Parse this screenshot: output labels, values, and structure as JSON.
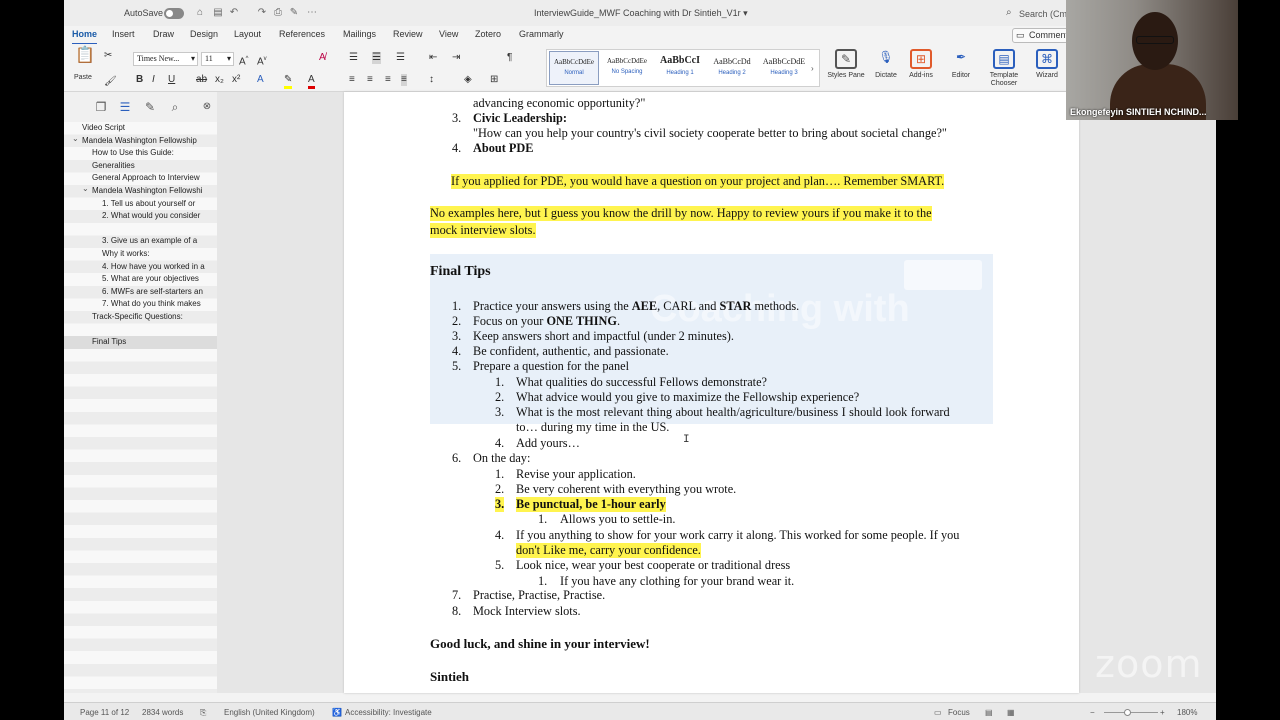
{
  "titlebar": {
    "autosave": "AutoSave",
    "filename": "InterviewGuide_MWF Coaching with Dr Sintieh_V1r",
    "search": "Search (Cm"
  },
  "tabs": [
    "Home",
    "Insert",
    "Draw",
    "Design",
    "Layout",
    "References",
    "Mailings",
    "Review",
    "View",
    "Zotero",
    "Grammarly"
  ],
  "comment": "Comment",
  "ribbon": {
    "paste": "Paste",
    "font": "Times New...",
    "size": "11",
    "styles": [
      {
        "preview": "AaBbCcDdEe",
        "name": "Normal"
      },
      {
        "preview": "AaBbCcDdEe",
        "name": "No Spacing"
      },
      {
        "preview": "AaBbCcI",
        "name": "Heading 1"
      },
      {
        "preview": "AaBbCcDd",
        "name": "Heading 2"
      },
      {
        "preview": "AaBbCcDdE",
        "name": "Heading 3"
      }
    ],
    "styles_pane": "Styles Pane",
    "dictate": "Dictate",
    "addins": "Add-ins",
    "editor": "Editor",
    "template": "Template Chooser",
    "wizard": "Wizard"
  },
  "nav": {
    "items": [
      "Video Script",
      "Mandela Washington Fellowship",
      "How to Use this Guide:",
      "Generalities",
      "General Approach to Interview",
      "Mandela Washington Fellowshi",
      "1. Tell us about yourself or",
      "2. What would you consider",
      "",
      "3. Give us an example of a",
      "Why it works:",
      "4. How have you worked in a",
      "5. What are your objectives",
      "6. MWFs are self-starters an",
      "7. What do you think makes",
      "Track-Specific Questions:",
      "",
      "Final Tips"
    ]
  },
  "doc": {
    "l1": "advancing economic opportunity?\"",
    "n3": "3.",
    "civic": "Civic Leadership:",
    "civic_q": "\"How can you help your country's civil society cooperate better to bring about societal change?\"",
    "n4": "4.",
    "about": "About PDE",
    "pde": "If you applied for PDE, you would have a question on your project and plan…. Remember SMART.",
    "noex1": "No examples here, but I guess you know the drill by now.  Happy to review yours if you make it to the",
    "noex2": "mock interview slots.",
    "final": "Final Tips",
    "t1a": "Practice your answers using the ",
    "t1b": "AEE",
    "t1c": ", CARL and ",
    "t1d": "STAR",
    "t1e": " methods.",
    "t2a": "Focus on your ",
    "t2b": "ONE THING",
    ".": ".",
    "t3": "Keep answers short and impactful (under 2 minutes).",
    "t4": "Be confident, authentic, and passionate.",
    "t5": "Prepare a question for the panel",
    "t5_1": "What qualities do successful Fellows demonstrate?",
    "t5_2": "What advice would you give to maximize the Fellowship experience?",
    "t5_3a": "What is the most relevant thing about health/agriculture/business I should look forward",
    "t5_3b": "to… during my time in the US.",
    "t5_4": "Add yours…",
    "t6": "On the day:",
    "t6_1": "Revise your application.",
    "t6_2": "Be very coherent with everything you wrote.",
    "t6_3": "Be punctual, be 1-hour early",
    "t6_3_1": "Allows you to settle-in.",
    "t6_4a": "If you anything to show for your work carry it along. This worked for some people. If you",
    "t6_4b": "don't Like me, carry your confidence.",
    "t6_5": "Look nice, wear your best cooperate or traditional dress",
    "t6_5_1": "If you have any clothing for your brand wear it.",
    "t7": "Practise, Practise, Practise.",
    "t8": "Mock Interview slots.",
    "luck": "Good luck, and shine in your interview!",
    "sig": "Sintieh",
    "banner_wm": "Coaching with"
  },
  "status": {
    "page": "Page 11 of 12",
    "words": "2834 words",
    "lang": "English (United Kingdom)",
    "access": "Accessibility: Investigate",
    "focus": "Focus",
    "zoom": "180%"
  },
  "video": {
    "name": "Ekongefeyin SINTIEH NCHIND...",
    "watermark": "zoom"
  }
}
